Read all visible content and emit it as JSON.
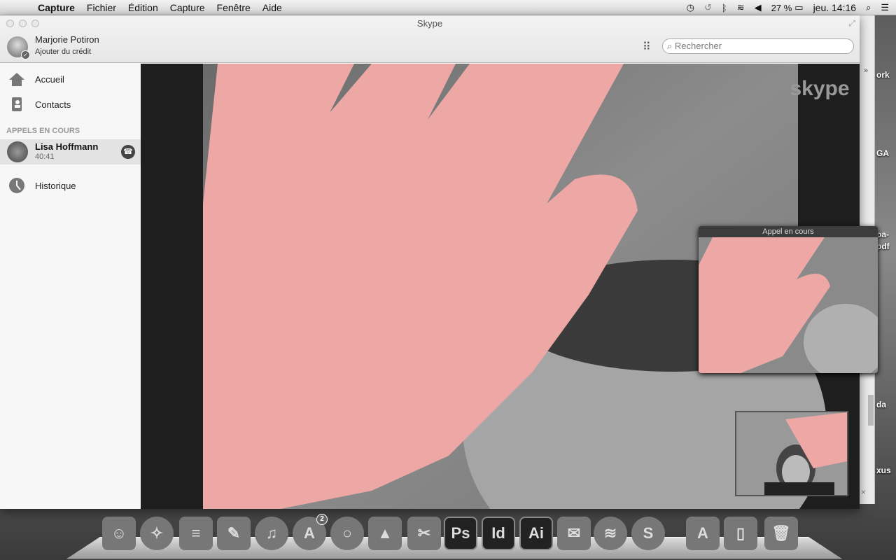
{
  "menubar": {
    "app": "Capture",
    "items": [
      "Fichier",
      "Édition",
      "Capture",
      "Fenêtre",
      "Aide"
    ],
    "battery": "27 %",
    "clock": "jeu. 14:16"
  },
  "window": {
    "title": "Skype",
    "user_name": "Marjorie Potiron",
    "credit_link": "Ajouter du crédit",
    "search_placeholder": "Rechercher"
  },
  "sidebar": {
    "items": [
      {
        "label": "Accueil",
        "icon": "home-icon"
      },
      {
        "label": "Contacts",
        "icon": "contacts-icon"
      },
      {
        "label": "Historique",
        "icon": "clock-icon"
      }
    ],
    "section": "APPELS EN COURS",
    "call": {
      "name": "Lisa Hoffmann",
      "duration": "40:41"
    }
  },
  "video": {
    "logo": "skype",
    "pip_title": "Appel en cours"
  },
  "desktop": {
    "labels": [
      "ork",
      "GA",
      "pa-",
      "pdf",
      "da",
      "xus"
    ]
  },
  "dock": {
    "apps": [
      {
        "name": "Finder",
        "glyph": "☺"
      },
      {
        "name": "Safari",
        "glyph": "✧"
      },
      {
        "name": "Notes",
        "glyph": "≡"
      },
      {
        "name": "Pages",
        "glyph": "✎"
      },
      {
        "name": "iTunes",
        "glyph": "♫"
      },
      {
        "name": "App Store",
        "glyph": "A",
        "badge": "2"
      },
      {
        "name": "Chrome",
        "glyph": "○"
      },
      {
        "name": "VLC",
        "glyph": "▲"
      },
      {
        "name": "Capture",
        "glyph": "✂"
      },
      {
        "name": "Photoshop",
        "glyph": "Ps"
      },
      {
        "name": "InDesign",
        "glyph": "Id"
      },
      {
        "name": "Illustrator",
        "glyph": "Ai"
      },
      {
        "name": "Mail",
        "glyph": "✉"
      },
      {
        "name": "Spotify",
        "glyph": "≋"
      },
      {
        "name": "Skype",
        "glyph": "S"
      },
      {
        "name": "Applications",
        "glyph": "A"
      },
      {
        "name": "Documents",
        "glyph": "▯"
      },
      {
        "name": "Trash",
        "glyph": "🗑"
      }
    ]
  },
  "colors": {
    "skin": "#eda8a6"
  }
}
